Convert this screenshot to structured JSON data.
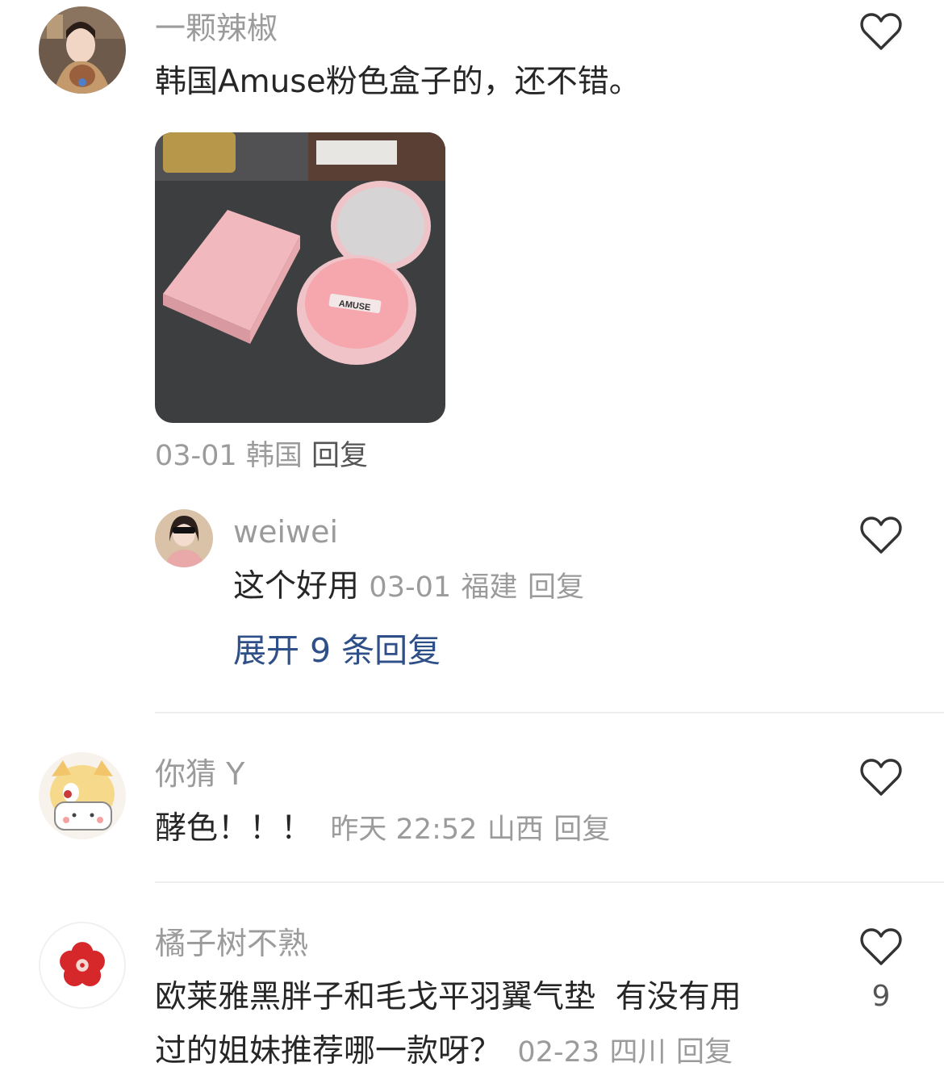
{
  "comments": [
    {
      "author": "一颗辣椒",
      "text": "韩国Amuse粉色盒子的，还不错。",
      "image": {
        "brand_text": "AMUSE"
      },
      "date": "03-01",
      "location": "韩国",
      "reply_label": "回复",
      "reply": {
        "author": "weiwei",
        "text": "这个好用",
        "date": "03-01",
        "location": "福建",
        "reply_label": "回复"
      },
      "expand_label": "展开 9 条回复"
    },
    {
      "author": "你猜 Y",
      "text": "酵色！！！",
      "time": "昨天 22:52",
      "location": "山西",
      "reply_label": "回复"
    },
    {
      "author": "橘子树不熟",
      "text_line1": "欧莱雅黑胖子和毛戈平羽翼气垫  有没有用",
      "text_line2": "过的姐妹推荐哪一款呀？",
      "date": "02-23",
      "location": "四川",
      "reply_label": "回复",
      "likes": "9"
    }
  ],
  "icons": {
    "like": "heart-outline-icon"
  },
  "colors": {
    "expand_link": "#2e4f87",
    "meta_gray": "#9b9b9b",
    "heart_stroke": "#333333"
  }
}
